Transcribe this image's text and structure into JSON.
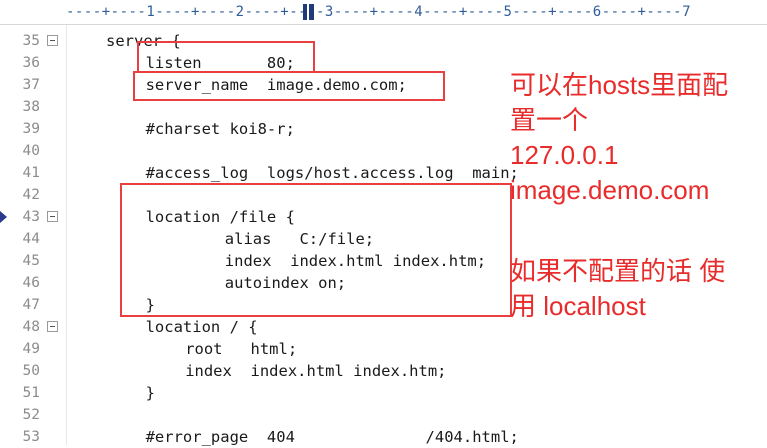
{
  "ruler": {
    "text": "----+----1----+----2----+----3----+----4----+----5----+----6----+----7"
  },
  "lines": [
    {
      "num": "35",
      "code": "server {",
      "indent": 0,
      "fold": true
    },
    {
      "num": "36",
      "code": "listen       80;",
      "indent": 1,
      "fold": false
    },
    {
      "num": "37",
      "code": "server_name  image.demo.com;",
      "indent": 1,
      "fold": false
    },
    {
      "num": "38",
      "code": "",
      "indent": 0,
      "fold": false
    },
    {
      "num": "39",
      "code": "#charset koi8-r;",
      "indent": 1,
      "fold": false
    },
    {
      "num": "40",
      "code": "",
      "indent": 0,
      "fold": false
    },
    {
      "num": "41",
      "code": "#access_log  logs/host.access.log  main;",
      "indent": 1,
      "fold": false
    },
    {
      "num": "42",
      "code": "",
      "indent": 0,
      "fold": false
    },
    {
      "num": "43",
      "code": "location /file {",
      "indent": 1,
      "fold": true,
      "bookmark": true
    },
    {
      "num": "44",
      "code": "alias   C:/file;",
      "indent": 3,
      "fold": false
    },
    {
      "num": "45",
      "code": "index  index.html index.htm;",
      "indent": 3,
      "fold": false
    },
    {
      "num": "46",
      "code": "autoindex on;",
      "indent": 3,
      "fold": false
    },
    {
      "num": "47",
      "code": "}",
      "indent": 1,
      "fold": false
    },
    {
      "num": "48",
      "code": "location / {",
      "indent": 1,
      "fold": true
    },
    {
      "num": "49",
      "code": "root   html;",
      "indent": 2,
      "fold": false
    },
    {
      "num": "50",
      "code": "index  index.html index.htm;",
      "indent": 2,
      "fold": false
    },
    {
      "num": "51",
      "code": "}",
      "indent": 1,
      "fold": false
    },
    {
      "num": "52",
      "code": "",
      "indent": 0,
      "fold": false
    },
    {
      "num": "53",
      "code": "#error_page  404              /404.html;",
      "indent": 1,
      "fold": false
    }
  ],
  "annotations": {
    "note1": "可以在hosts里面配\n置一个\n127.0.0.1\nimage.demo.com",
    "note2": "如果不配置的话 使\n用 localhost"
  },
  "colors": {
    "annotation_red": "#e82c2c",
    "box_red": "#e8403f",
    "line_number_gray": "#8c8c8c",
    "ruler_blue": "#2f5d9a"
  }
}
